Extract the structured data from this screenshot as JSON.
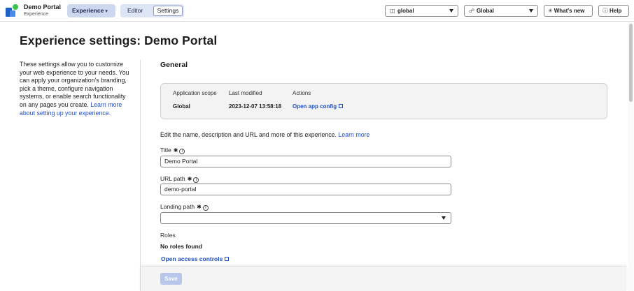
{
  "app": {
    "name": "Demo Portal",
    "type": "Experience"
  },
  "header": {
    "experience_menu": "Experience",
    "modes": {
      "editor": "Editor",
      "settings": "Settings",
      "active": "Settings"
    },
    "scope_select": "global",
    "global_select": "Global",
    "whats_new": "What's new",
    "help": "Help"
  },
  "page": {
    "title": "Experience settings: Demo Portal",
    "description": "These settings allow you to customize your web experience to your needs. You can apply your organization's branding, pick a theme, configure navigation systems, or enable search functionality on any pages you create.",
    "description_link": "Learn more about setting up your experience."
  },
  "general": {
    "section_title": "General",
    "info_card": {
      "headers": {
        "scope": "Application scope",
        "modified": "Last modified",
        "actions": "Actions"
      },
      "scope": "Global",
      "modified": "2023-12-07 13:58:18",
      "action_link": "Open app config"
    },
    "intro_text": "Edit the name, description and URL and more of this experience.",
    "intro_link": "Learn more",
    "fields": {
      "title_label": "Title",
      "title_value": "Demo Portal",
      "url_label": "URL path",
      "url_value": "demo-portal",
      "landing_label": "Landing path",
      "landing_value": ""
    },
    "roles": {
      "label": "Roles",
      "value": "No roles found",
      "link": "Open access controls"
    }
  },
  "footer": {
    "save_label": "Save"
  },
  "icons": {
    "experience_caret": "chevron-down-icon",
    "scope": "scope-icon",
    "global": "globe-icon",
    "whats_new": "sparkle-icon",
    "help": "help-icon",
    "external": "external-link-icon",
    "required": "asterisk-icon",
    "info": "info-icon"
  },
  "colors": {
    "link": "#1f4fc8",
    "experience_pill": "#cdd8ef",
    "save_disabled": "#b9c6ec"
  }
}
